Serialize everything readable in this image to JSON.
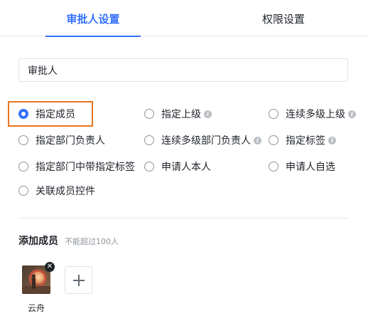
{
  "tabs": [
    {
      "label": "审批人设置",
      "active": true
    },
    {
      "label": "权限设置",
      "active": false
    }
  ],
  "approver_name": {
    "value": "审批人"
  },
  "options": [
    {
      "label": "指定成员",
      "checked": true,
      "info": false
    },
    {
      "label": "指定上级",
      "checked": false,
      "info": true
    },
    {
      "label": "连续多级上级",
      "checked": false,
      "info": true
    },
    {
      "label": "指定部门负责人",
      "checked": false,
      "info": false
    },
    {
      "label": "连续多级部门负责人",
      "checked": false,
      "info": true
    },
    {
      "label": "指定标签",
      "checked": false,
      "info": true
    },
    {
      "label": "指定部门中带指定标签",
      "checked": false,
      "info": false
    },
    {
      "label": "申请人本人",
      "checked": false,
      "info": false
    },
    {
      "label": "申请人自选",
      "checked": false,
      "info": false
    },
    {
      "label": "关联成员控件",
      "checked": false,
      "info": false
    }
  ],
  "members": {
    "title": "添加成员",
    "hint": "不能超过100人",
    "list": [
      {
        "name": "云舟"
      }
    ]
  },
  "colors": {
    "accent": "#3370ff",
    "highlight": "#e8731e"
  }
}
